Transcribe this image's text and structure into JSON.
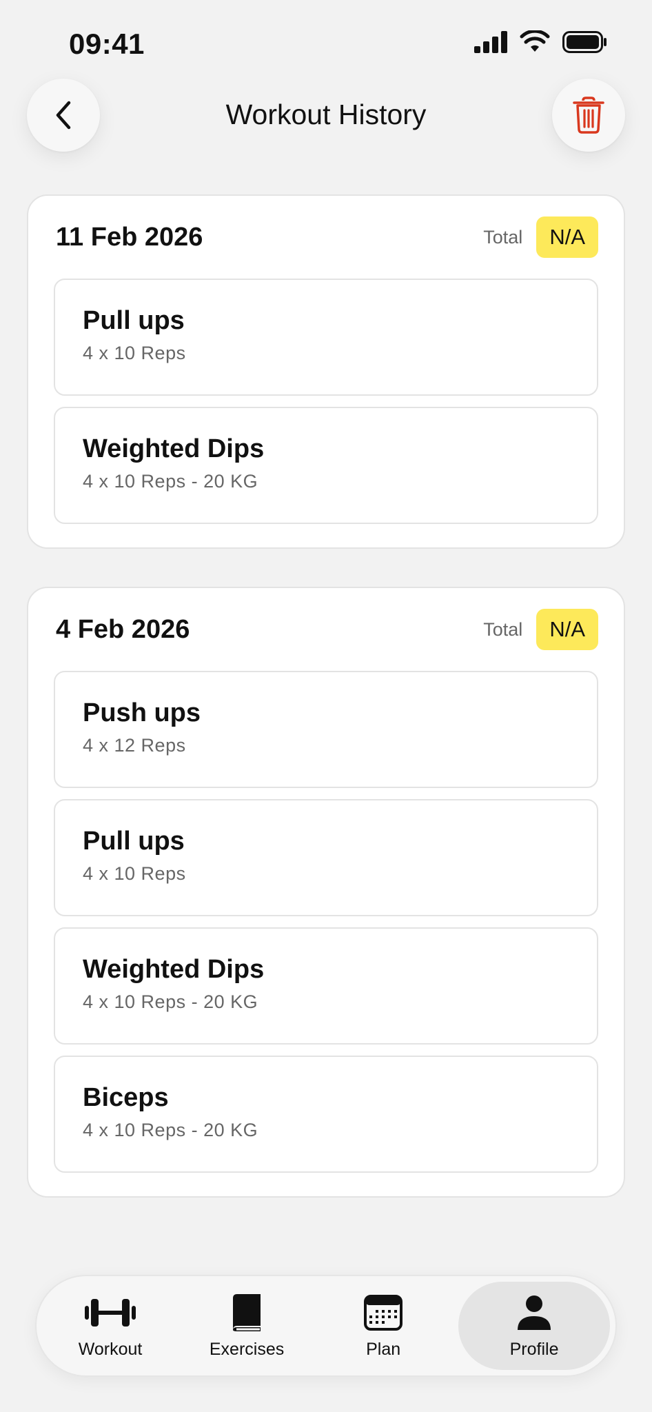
{
  "status": {
    "time": "09:41"
  },
  "header": {
    "title": "Workout History",
    "back_icon": "chevron-left-icon",
    "trash_icon": "trash-icon",
    "trash_color": "#d9381e"
  },
  "days": [
    {
      "date": "11 Feb 2026",
      "total_label": "Total",
      "total_value": "N/A",
      "exercises": [
        {
          "name": "Pull ups",
          "detail": "4 x 10 Reps"
        },
        {
          "name": "Weighted Dips",
          "detail": "4 x 10 Reps - 20 KG"
        }
      ]
    },
    {
      "date": "4 Feb 2026",
      "total_label": "Total",
      "total_value": "N/A",
      "exercises": [
        {
          "name": "Push ups",
          "detail": "4 x 12 Reps"
        },
        {
          "name": "Pull ups",
          "detail": "4 x 10 Reps"
        },
        {
          "name": "Weighted Dips",
          "detail": "4 x 10 Reps - 20 KG"
        },
        {
          "name": "Biceps",
          "detail": "4 x 10 Reps - 20 KG"
        }
      ]
    }
  ],
  "tabs": [
    {
      "label": "Workout",
      "icon": "dumbbell-icon"
    },
    {
      "label": "Exercises",
      "icon": "book-icon"
    },
    {
      "label": "Plan",
      "icon": "calendar-icon"
    },
    {
      "label": "Profile",
      "icon": "person-icon",
      "active": true
    }
  ],
  "colors": {
    "badge": "#fde95a",
    "background": "#f2f2f2"
  }
}
